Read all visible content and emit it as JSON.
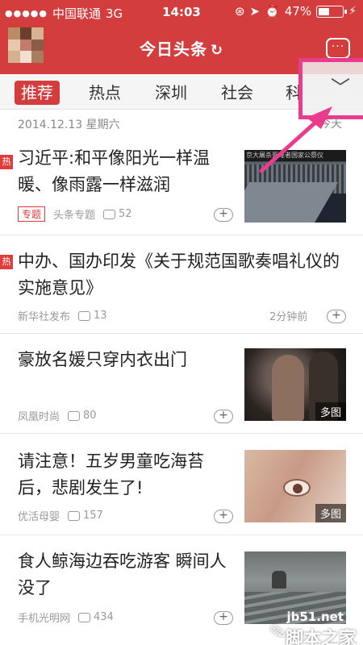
{
  "status_bar": {
    "signal_dots": "●●●●●",
    "carrier": "中国联通",
    "network": "3G",
    "time": "14:03",
    "battery": "47%",
    "battery_fraction": 0.47
  },
  "header": {
    "title": "今日头条"
  },
  "tabs": [
    {
      "label": "推荐",
      "active": true
    },
    {
      "label": "热点"
    },
    {
      "label": "深圳"
    },
    {
      "label": "社会"
    },
    {
      "label": "科技"
    }
  ],
  "dateline": {
    "date": "2014.12.13 星期六",
    "right": "今天"
  },
  "feed": [
    {
      "hot_badge": "热",
      "title": "习近平:和平像阳光一样温暖、像雨露一样滋润",
      "tag": "专题",
      "source": "头条专题",
      "comments": "52",
      "thumb_caption": "京大屠杀死难者国家公祭仪"
    },
    {
      "hot_badge": "热",
      "title": "中办、国办印发《关于规范国歌奏唱礼仪的实施意见》",
      "source": "新华社发布",
      "comments": "13",
      "time": "2分钟前"
    },
    {
      "title": "豪放名媛只穿内衣出门",
      "source": "凤凰时尚",
      "comments": "80",
      "multi": "多图"
    },
    {
      "title": "请注意！五岁男童吃海苔后，悲剧发生了!",
      "source": "优活母婴",
      "comments": "157",
      "multi": "多图"
    },
    {
      "title": "食人鲸海边吞吃游客 瞬间人没了",
      "source": "手机光明网",
      "comments": "434"
    }
  ],
  "watermark": {
    "site": "jb51.net",
    "name": "脚本之家"
  },
  "colors": {
    "brand_red": "#d43d3d",
    "highlight_pink": "#ea3c8f"
  }
}
